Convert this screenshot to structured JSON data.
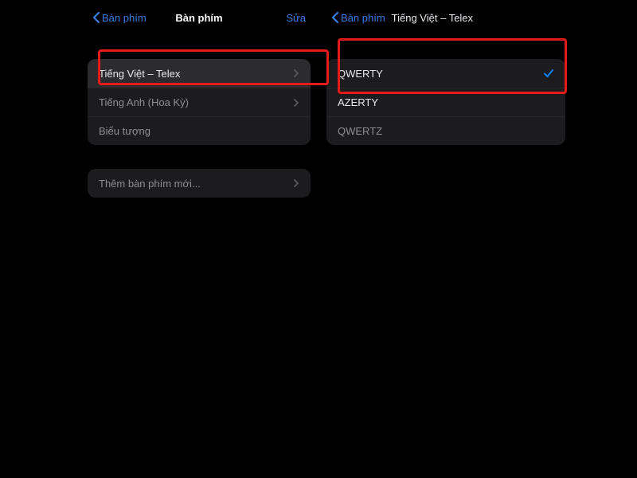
{
  "left": {
    "back_label": "Bàn phím",
    "title": "Bàn phím",
    "edit_label": "Sửa",
    "items": [
      {
        "label": "Tiếng Việt – Telex",
        "has_chevron": true,
        "highlighted": true
      },
      {
        "label": "Tiếng Anh (Hoa Kỳ)",
        "has_chevron": true,
        "highlighted": false
      },
      {
        "label": "Biểu tượng",
        "has_chevron": false,
        "highlighted": false
      }
    ],
    "add_new": {
      "label": "Thêm bàn phím mới...",
      "has_chevron": true
    }
  },
  "right": {
    "back_label": "Bàn phím",
    "title": "Tiếng Việt – Telex",
    "options": [
      {
        "label": "QWERTY",
        "selected": true
      },
      {
        "label": "AZERTY",
        "selected": false
      },
      {
        "label": "QWERTZ",
        "selected": false
      }
    ]
  }
}
